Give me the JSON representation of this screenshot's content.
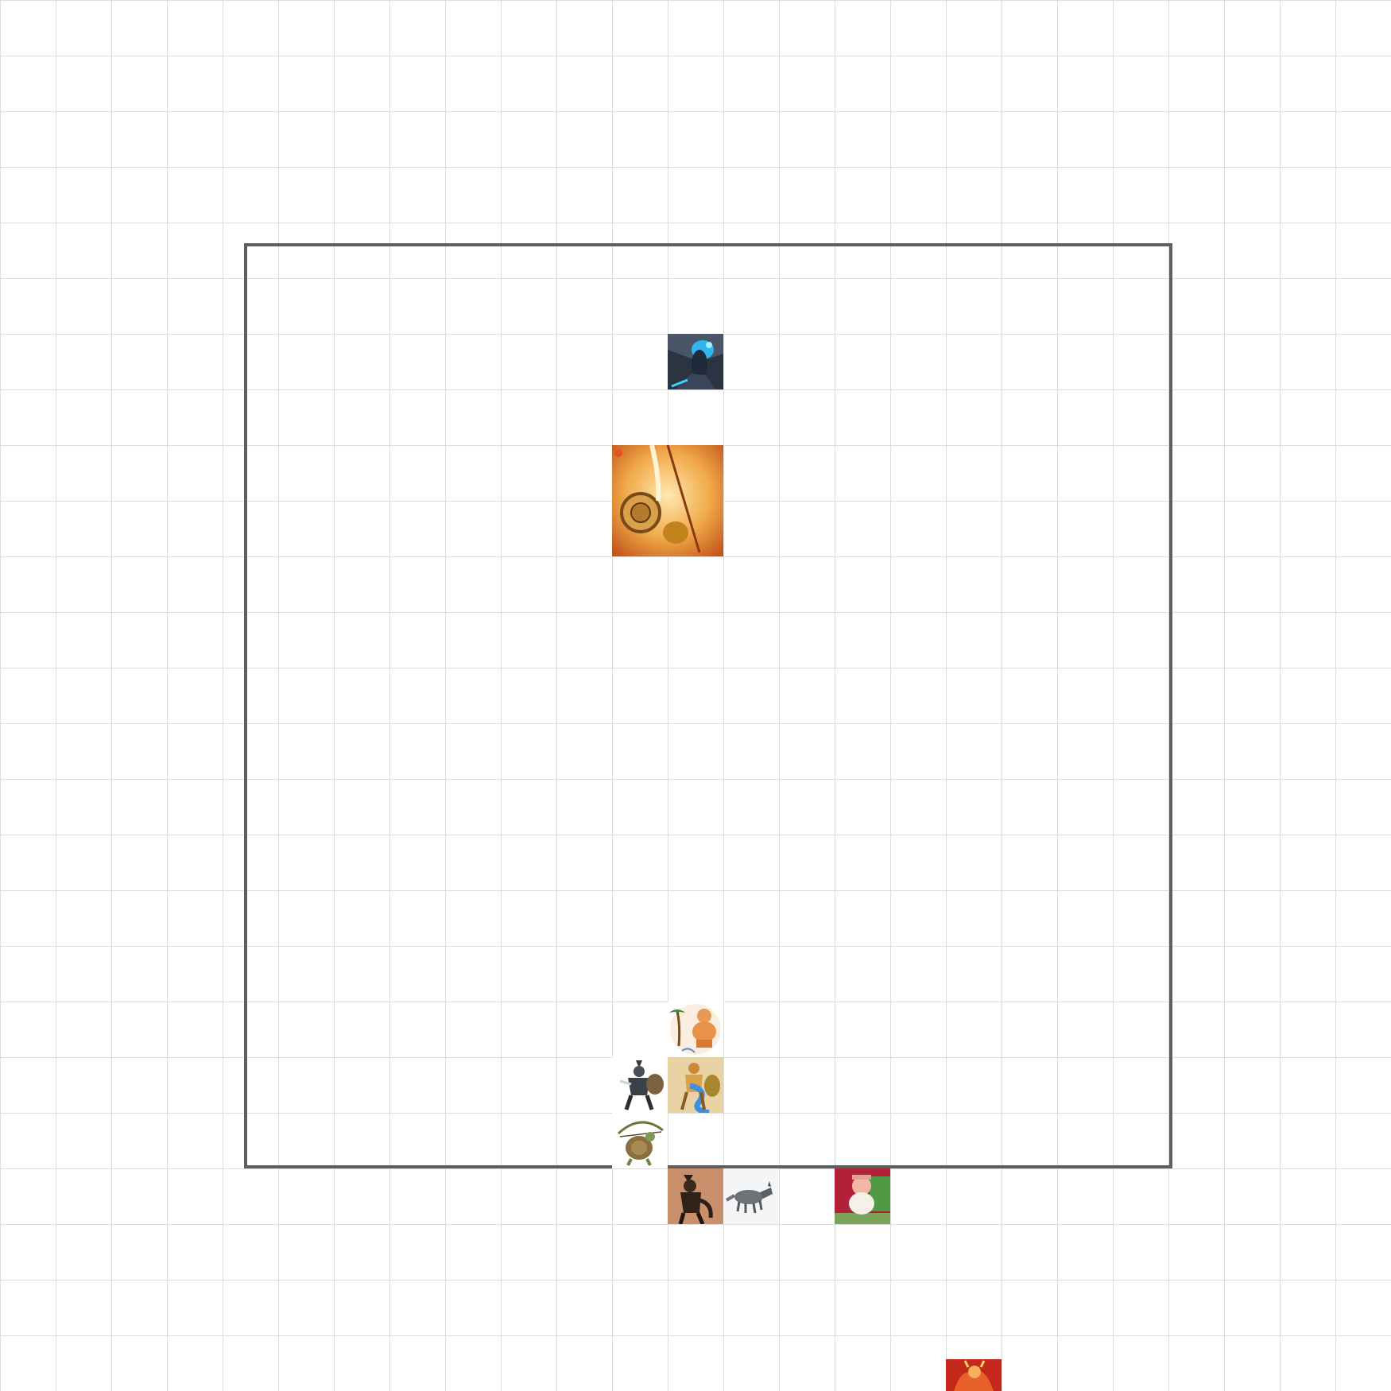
{
  "board": {
    "grid_color": "#dcdcdc",
    "frame_color": "#5f5f5f",
    "background": "#ffffff"
  },
  "tokens": [
    {
      "name": "frost-knight-token",
      "icon": "frost-knight-portrait"
    },
    {
      "name": "golden-sun-warrior-token",
      "icon": "golden-sun-warrior-portrait"
    },
    {
      "name": "tropical-strongman-token",
      "icon": "tropical-strongman-portrait"
    },
    {
      "name": "armored-raven-knight-token",
      "icon": "armored-knight-portrait"
    },
    {
      "name": "water-champion-token",
      "icon": "water-champion-portrait"
    },
    {
      "name": "turtle-archer-token",
      "icon": "turtle-archer-portrait"
    },
    {
      "name": "feline-rogue-token",
      "icon": "feline-rogue-portrait"
    },
    {
      "name": "grey-wolf-token",
      "icon": "wolf-portrait"
    },
    {
      "name": "cartoon-pig-token",
      "icon": "cartoon-character-portrait"
    },
    {
      "name": "fire-demon-token",
      "icon": "fire-demon-portrait"
    }
  ]
}
